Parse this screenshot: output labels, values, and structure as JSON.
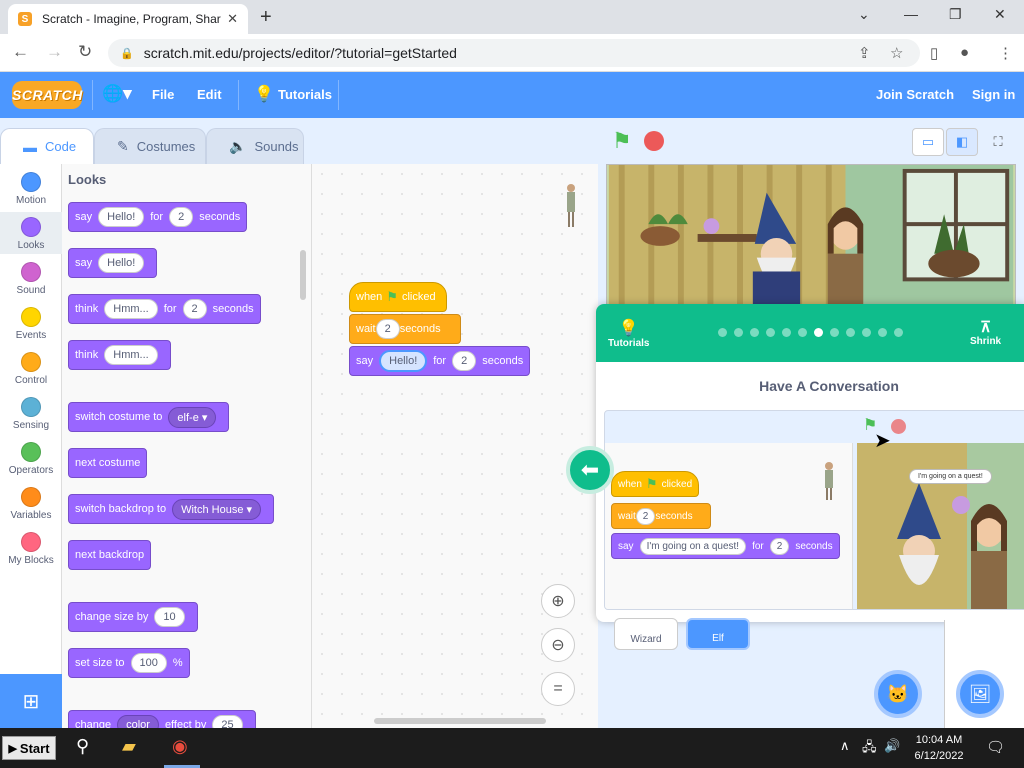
{
  "browser": {
    "tab_title": "Scratch - Imagine, Program, Shar",
    "tab_close": "✕",
    "new_tab": "+",
    "url": "scratch.mit.edu/projects/editor/?tutorial=getStarted",
    "favicon_letter": "S"
  },
  "menu": {
    "logo": "SCRATCH",
    "file": "File",
    "edit": "Edit",
    "tutorials": "Tutorials",
    "join": "Join Scratch",
    "signin": "Sign in"
  },
  "editor_tabs": {
    "code": "Code",
    "costumes": "Costumes",
    "sounds": "Sounds"
  },
  "categories": [
    {
      "label": "Motion",
      "color": "#4c97ff"
    },
    {
      "label": "Looks",
      "color": "#9966ff"
    },
    {
      "label": "Sound",
      "color": "#cf63cf"
    },
    {
      "label": "Events",
      "color": "#ffd500"
    },
    {
      "label": "Control",
      "color": "#ffab19"
    },
    {
      "label": "Sensing",
      "color": "#5cb1d6"
    },
    {
      "label": "Operators",
      "color": "#59c059"
    },
    {
      "label": "Variables",
      "color": "#ff8c1a"
    },
    {
      "label": "My Blocks",
      "color": "#ff6680"
    }
  ],
  "palette": {
    "title": "Looks",
    "say_for": {
      "say": "say",
      "msg": "Hello!",
      "for": "for",
      "secs": "2",
      "seconds": "seconds"
    },
    "say": {
      "say": "say",
      "msg": "Hello!"
    },
    "think_for": {
      "think": "think",
      "msg": "Hmm...",
      "for": "for",
      "secs": "2",
      "seconds": "seconds"
    },
    "think": {
      "think": "think",
      "msg": "Hmm..."
    },
    "switch_costume": {
      "label": "switch costume to",
      "value": "elf-e"
    },
    "next_costume": "next costume",
    "switch_backdrop": {
      "label": "switch backdrop to",
      "value": "Witch House"
    },
    "next_backdrop": "next backdrop",
    "change_size": {
      "label": "change size by",
      "value": "10"
    },
    "set_size": {
      "label": "set size to",
      "value": "100",
      "unit": "%"
    },
    "change_effect": {
      "label": "change",
      "drop": "color",
      "mid": "effect by",
      "value": "25"
    }
  },
  "script": {
    "when": "when",
    "clicked": "clicked",
    "wait": "wait",
    "wait_secs": "2",
    "seconds": "seconds",
    "say": "say",
    "say_msg": "Hello!",
    "for": "for",
    "say_secs": "2"
  },
  "tutorial": {
    "tutorials_label": "Tutorials",
    "shrink_label": "Shrink",
    "title": "Have A Conversation",
    "total_steps": 12,
    "current_step": 7,
    "script": {
      "when": "when",
      "clicked": "clicked",
      "wait": "wait",
      "wait_secs": "2",
      "seconds": "seconds",
      "say": "say",
      "say_msg": "I'm going on a quest!",
      "for": "for",
      "say_secs": "2"
    },
    "speech": "I'm going on a quest!"
  },
  "sprites": {
    "wizard": "Wizard",
    "elf": "Elf"
  },
  "taskbar": {
    "start": "Start",
    "time": "10:04 AM",
    "date": "6/12/2022"
  }
}
